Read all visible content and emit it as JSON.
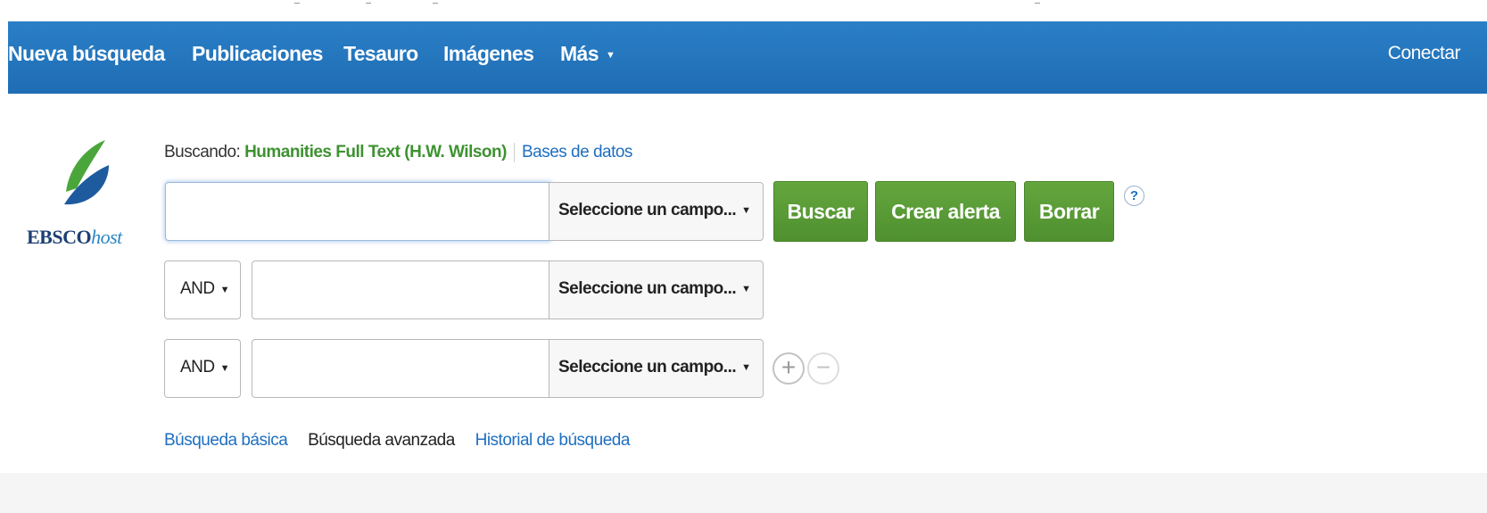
{
  "nav": {
    "items": [
      "Nueva búsqueda",
      "Publicaciones",
      "Tesauro",
      "Imágenes",
      "Más"
    ],
    "more_arrow": "▼",
    "connect": "Conectar"
  },
  "logo": {
    "brand": "EBSCO",
    "suffix": "host"
  },
  "searching": {
    "label": "Buscando:",
    "database": "Humanities Full Text (H.W. Wilson)",
    "databases_link": "Bases de datos"
  },
  "rows": [
    {
      "value": "",
      "field": "Seleccione un campo..."
    },
    {
      "boolean": "AND",
      "value": "",
      "field": "Seleccione un campo..."
    },
    {
      "boolean": "AND",
      "value": "",
      "field": "Seleccione un campo..."
    }
  ],
  "caret": "▼",
  "buttons": {
    "search": "Buscar",
    "alert": "Crear alerta",
    "clear": "Borrar",
    "help": "?",
    "add": "+",
    "remove": "−"
  },
  "links": {
    "basic": "Búsqueda básica",
    "advanced": "Búsqueda avanzada",
    "history": "Historial de búsqueda"
  },
  "colors": {
    "nav_blue": "#1f6db4",
    "button_green": "#5a9c36",
    "link_blue": "#1f6fc1",
    "db_green": "#3e9231"
  }
}
